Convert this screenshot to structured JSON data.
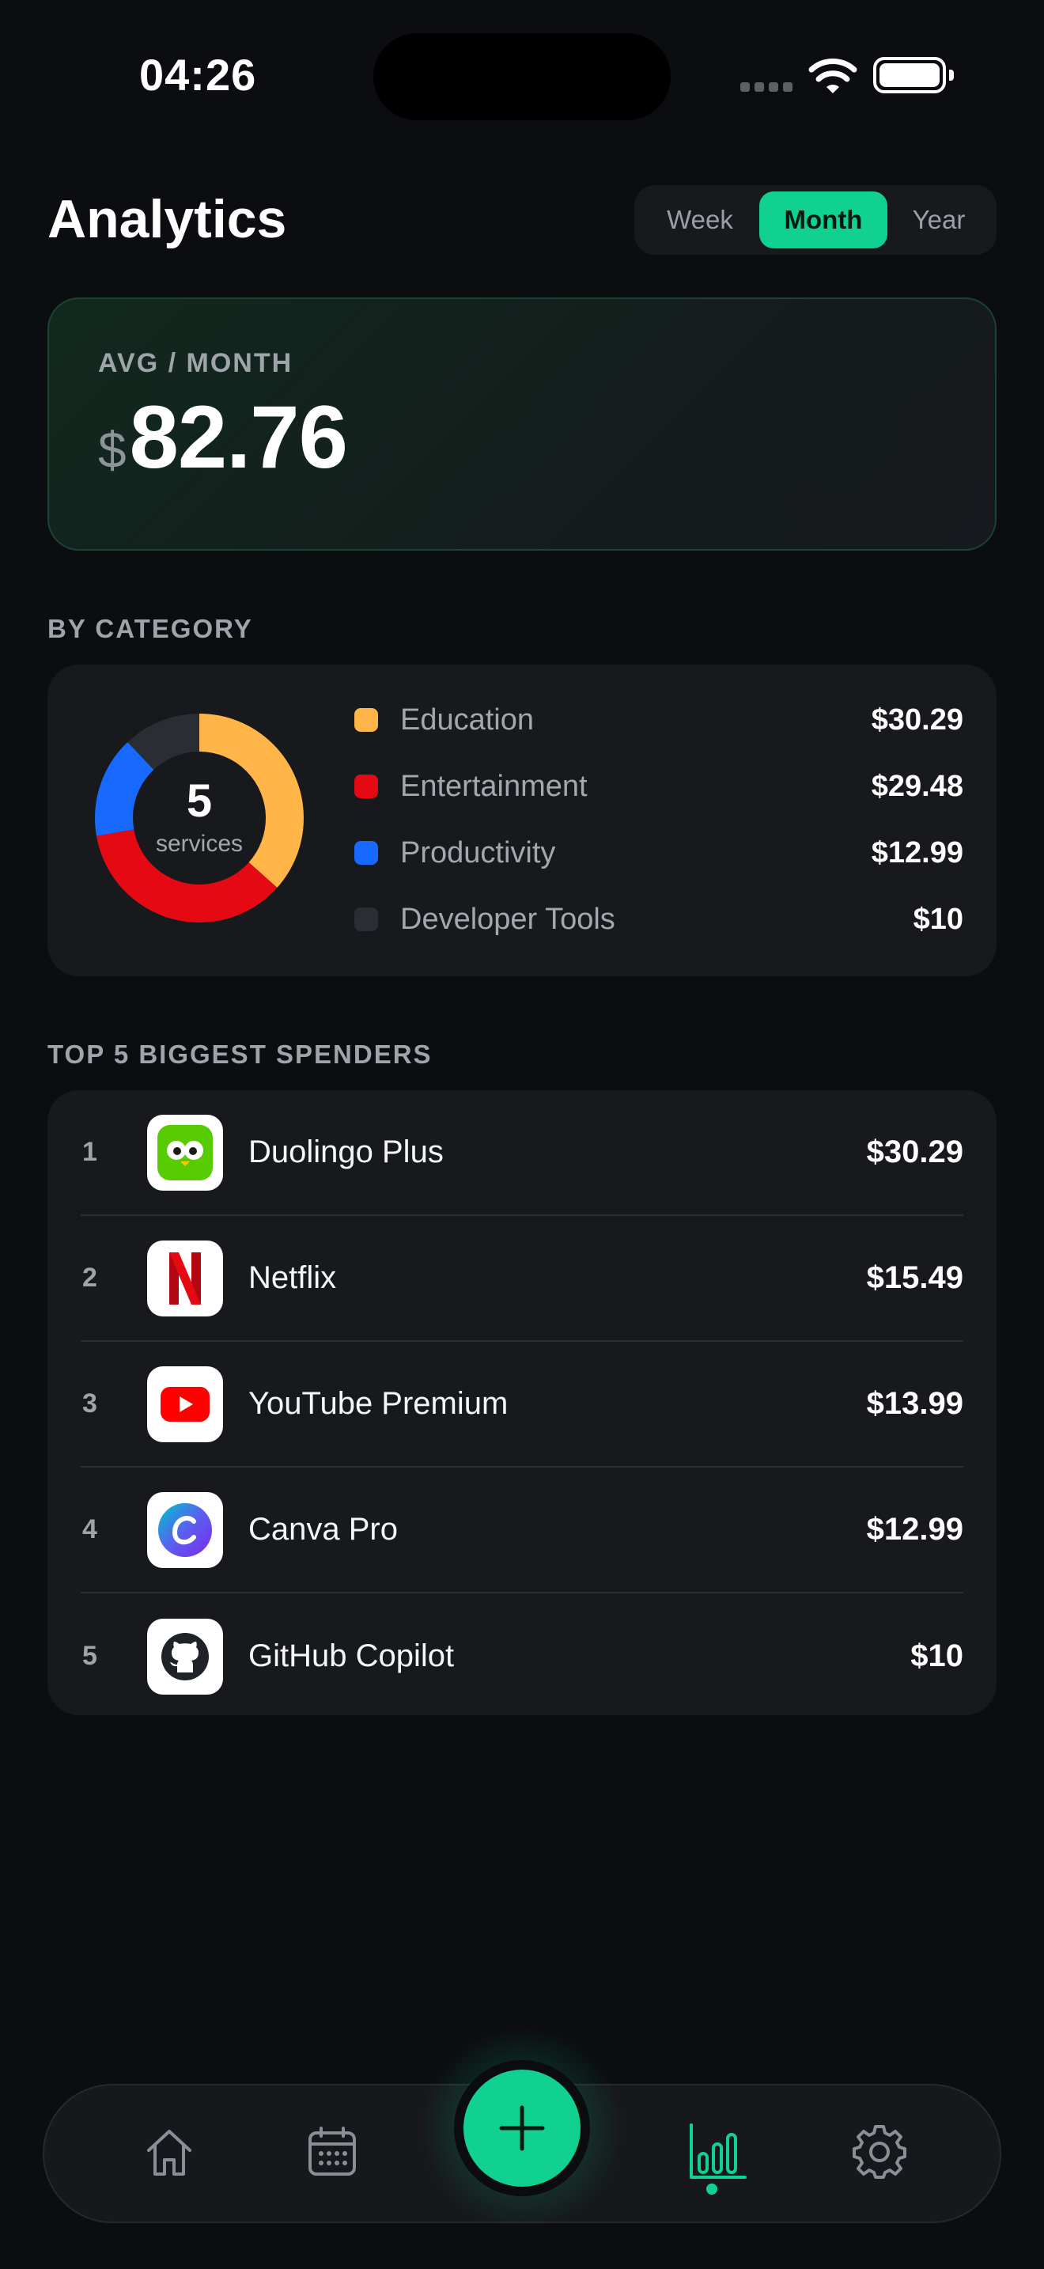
{
  "status_bar": {
    "time": "04:26"
  },
  "header": {
    "title": "Analytics",
    "periods": [
      "Week",
      "Month",
      "Year"
    ],
    "selected_period": "Month"
  },
  "avg_card": {
    "label": "AVG / MONTH",
    "currency": "$",
    "amount": "82.76"
  },
  "by_category": {
    "section_label": "BY CATEGORY",
    "total_count": "5",
    "total_label": "services",
    "items": [
      {
        "name": "Education",
        "value": "$30.29",
        "amount": 30.29,
        "color": "#ffb547"
      },
      {
        "name": "Entertainment",
        "value": "$29.48",
        "amount": 29.48,
        "color": "#e50914"
      },
      {
        "name": "Productivity",
        "value": "$12.99",
        "amount": 12.99,
        "color": "#1769ff"
      },
      {
        "name": "Developer Tools",
        "value": "$10",
        "amount": 10,
        "color": "#2a2d34"
      }
    ]
  },
  "top_spenders": {
    "section_label": "TOP 5 BIGGEST SPENDERS",
    "items": [
      {
        "rank": "1",
        "name": "Duolingo Plus",
        "value": "$30.29",
        "icon": "duolingo-icon"
      },
      {
        "rank": "2",
        "name": "Netflix",
        "value": "$15.49",
        "icon": "netflix-icon"
      },
      {
        "rank": "3",
        "name": "YouTube Premium",
        "value": "$13.99",
        "icon": "youtube-icon"
      },
      {
        "rank": "4",
        "name": "Canva Pro",
        "value": "$12.99",
        "icon": "canva-icon"
      },
      {
        "rank": "5",
        "name": "GitHub Copilot",
        "value": "$10",
        "icon": "github-icon"
      }
    ]
  },
  "nav": {
    "items": [
      "home-icon",
      "calendar-icon",
      "add-icon",
      "analytics-icon",
      "settings-icon"
    ],
    "active": "analytics-icon",
    "accent": "#10d18f"
  }
}
